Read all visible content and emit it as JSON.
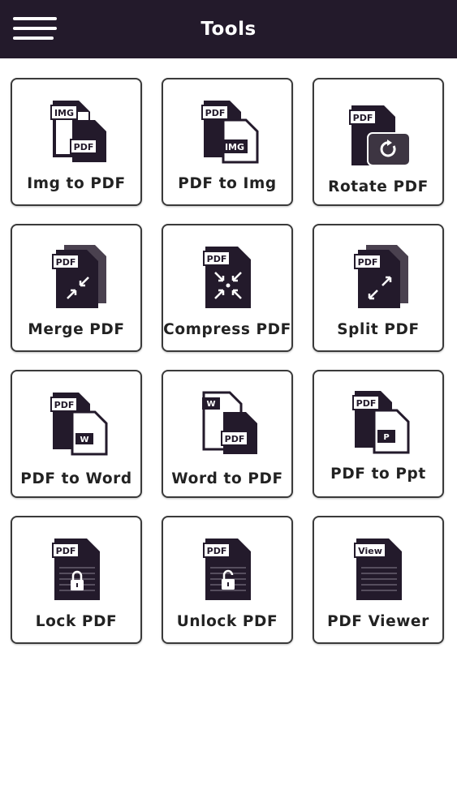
{
  "header": {
    "title": "Tools",
    "background": "#231a2b",
    "menu_icon": "hamburger-icon"
  },
  "tools": [
    {
      "id": "img-to-pdf",
      "label": "Img to PDF",
      "icon": "img-to-pdf-icon",
      "tags": [
        "IMG",
        "PDF"
      ]
    },
    {
      "id": "pdf-to-img",
      "label": "PDF to Img",
      "icon": "pdf-to-img-icon",
      "tags": [
        "PDF",
        "IMG"
      ]
    },
    {
      "id": "rotate-pdf",
      "label": "Rotate PDF",
      "icon": "rotate-pdf-icon",
      "tags": [
        "PDF"
      ]
    },
    {
      "id": "merge-pdf",
      "label": "Merge PDF",
      "icon": "merge-pdf-icon",
      "tags": [
        "PDF"
      ]
    },
    {
      "id": "compress-pdf",
      "label": "Compress PDF",
      "icon": "compress-pdf-icon",
      "tags": [
        "PDF"
      ]
    },
    {
      "id": "split-pdf",
      "label": "Split PDF",
      "icon": "split-pdf-icon",
      "tags": [
        "PDF"
      ]
    },
    {
      "id": "pdf-to-word",
      "label": "PDF to Word",
      "icon": "pdf-to-word-icon",
      "tags": [
        "PDF",
        "W"
      ]
    },
    {
      "id": "word-to-pdf",
      "label": "Word to PDF",
      "icon": "word-to-pdf-icon",
      "tags": [
        "W",
        "PDF"
      ]
    },
    {
      "id": "pdf-to-ppt",
      "label": "PDF to Ppt",
      "icon": "pdf-to-ppt-icon",
      "tags": [
        "PDF",
        "P"
      ]
    },
    {
      "id": "lock-pdf",
      "label": "Lock PDF",
      "icon": "lock-pdf-icon",
      "tags": [
        "PDF"
      ]
    },
    {
      "id": "unlock-pdf",
      "label": "Unlock PDF",
      "icon": "unlock-pdf-icon",
      "tags": [
        "PDF"
      ]
    },
    {
      "id": "pdf-viewer",
      "label": "PDF Viewer",
      "icon": "pdf-viewer-icon",
      "tags": [
        "View"
      ]
    }
  ],
  "colors": {
    "icon_dark": "#231a2b",
    "label_text": "#222222",
    "card_border": "#3a3a3a"
  }
}
